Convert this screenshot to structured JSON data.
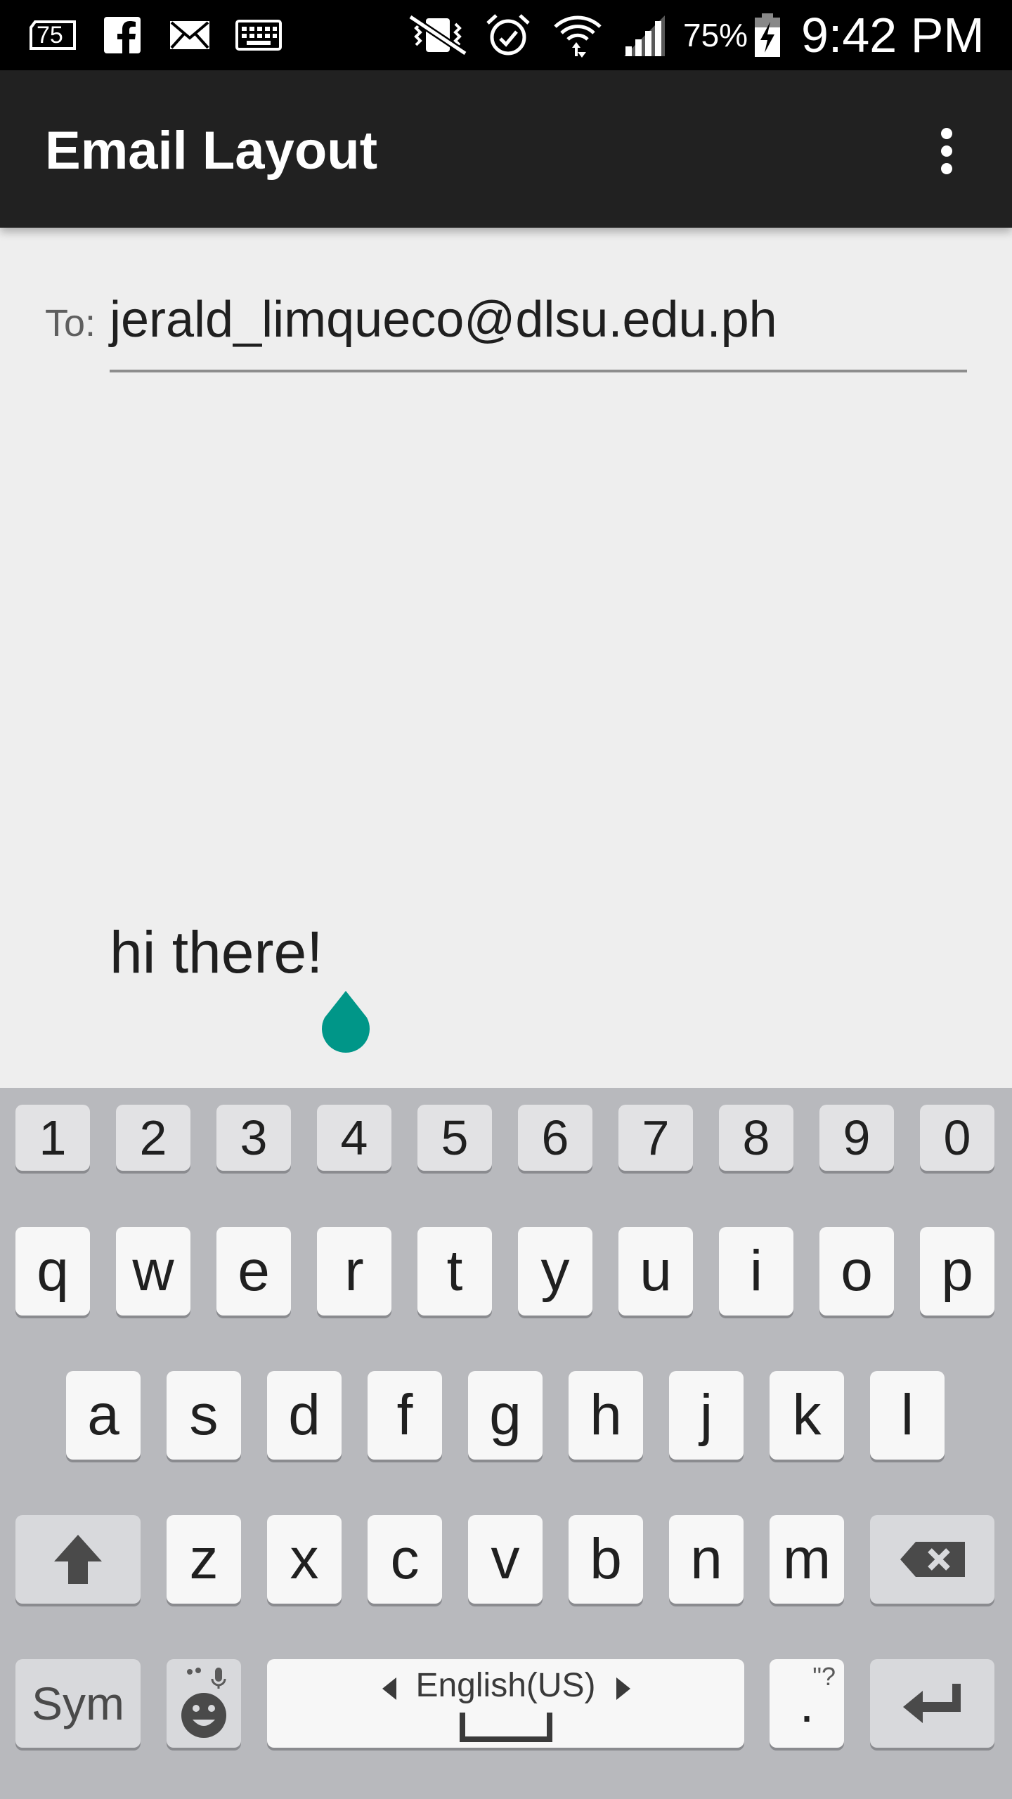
{
  "status_bar": {
    "notification_badge": "75",
    "battery_percent": "75%",
    "time": "9:42 PM",
    "icons": [
      "notification-75-icon",
      "facebook-icon",
      "mail-icon",
      "keyboard-icon",
      "vibrate-icon",
      "alarm-icon",
      "wifi-icon",
      "signal-icon",
      "battery-charging-icon"
    ]
  },
  "app_bar": {
    "title": "Email Layout",
    "overflow_icon": "more-vert-icon"
  },
  "compose": {
    "to_label": "To:",
    "to_value": "jerald_limqueco@dlsu.edu.ph",
    "body_value": "hi there!"
  },
  "colors": {
    "accent": "#009688",
    "app_bar": "#212121",
    "status_bar": "#000000",
    "background": "#eeeeee",
    "keyboard": "#b8b9bd"
  },
  "keyboard": {
    "number_row": [
      "1",
      "2",
      "3",
      "4",
      "5",
      "6",
      "7",
      "8",
      "9",
      "0"
    ],
    "row1": [
      "q",
      "w",
      "e",
      "r",
      "t",
      "y",
      "u",
      "i",
      "o",
      "p"
    ],
    "row2": [
      "a",
      "s",
      "d",
      "f",
      "g",
      "h",
      "j",
      "k",
      "l"
    ],
    "row3": [
      "z",
      "x",
      "c",
      "v",
      "b",
      "n",
      "m"
    ],
    "sym_label": "Sym",
    "space_label": "English(US)",
    "period_label": ".",
    "period_hint": "\"?",
    "shift_icon": "shift-icon",
    "backspace_icon": "backspace-icon",
    "emoji_icon": "emoji-mic-icon",
    "enter_icon": "enter-icon"
  }
}
